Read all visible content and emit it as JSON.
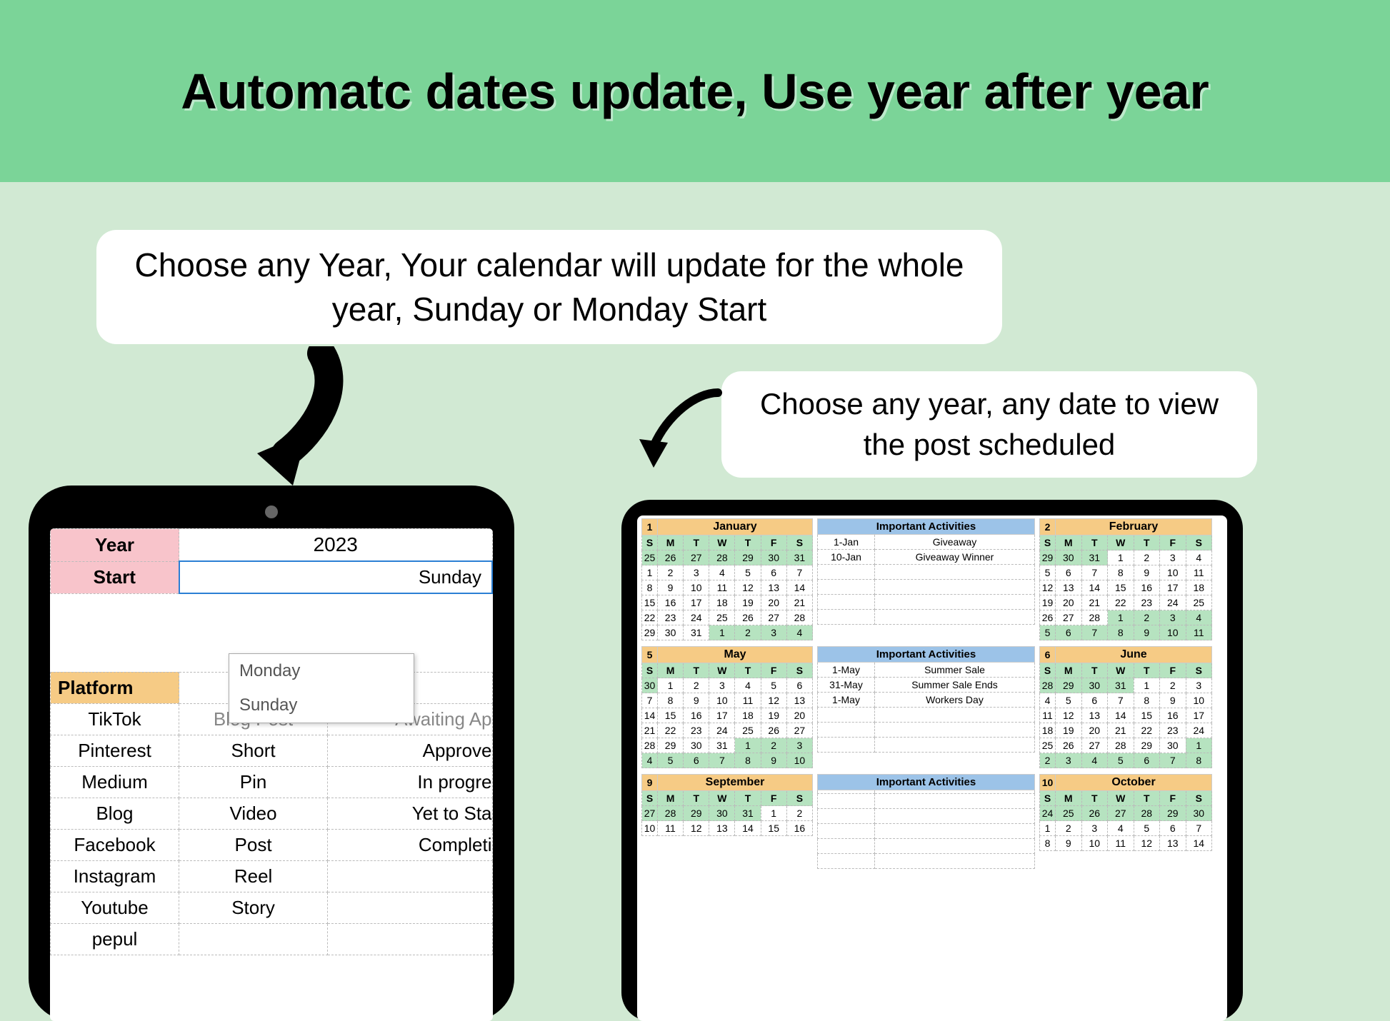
{
  "header": {
    "title": "Automatc dates update, Use year after year"
  },
  "caption1": "Choose any Year, Your calendar will update for the whole year, Sunday or Monday Start",
  "caption2": "Choose any year, any date to view the post scheduled",
  "sheet1": {
    "year_label": "Year",
    "year_value": "2023",
    "start_label": "Start",
    "start_value": "Sunday",
    "dropdown": [
      "Monday",
      "Sunday"
    ],
    "platform_header": "Platform",
    "rows": [
      {
        "platform": "TikTok",
        "type": "Blog Post",
        "status": "Awaiting Ap"
      },
      {
        "platform": "Pinterest",
        "type": "Short",
        "status": "Approve"
      },
      {
        "platform": "Medium",
        "type": "Pin",
        "status": "In progre"
      },
      {
        "platform": "Blog",
        "type": "Video",
        "status": "Yet to Sta"
      },
      {
        "platform": "Facebook",
        "type": "Post",
        "status": "Completi"
      },
      {
        "platform": "Instagram",
        "type": "Reel",
        "status": ""
      },
      {
        "platform": "Youtube",
        "type": "Story",
        "status": ""
      },
      {
        "platform": "pepul",
        "type": "",
        "status": ""
      }
    ]
  },
  "calendar": {
    "dow": [
      "S",
      "M",
      "T",
      "W",
      "T",
      "F",
      "S"
    ],
    "months": [
      {
        "num": "1",
        "name": "January",
        "activities_header": "Important Activities",
        "activities": [
          {
            "date": "1-Jan",
            "name": "Giveaway"
          },
          {
            "date": "10-Jan",
            "name": "Giveaway Winner"
          }
        ],
        "grid": [
          [
            "25p",
            "26p",
            "27p",
            "28p",
            "29p",
            "30p",
            "31p"
          ],
          [
            "1",
            "2",
            "3",
            "4",
            "5",
            "6",
            "7"
          ],
          [
            "8",
            "9",
            "10",
            "11",
            "12",
            "13",
            "14"
          ],
          [
            "15",
            "16",
            "17",
            "18",
            "19",
            "20",
            "21"
          ],
          [
            "22",
            "23",
            "24",
            "25",
            "26",
            "27",
            "28"
          ],
          [
            "29",
            "30",
            "31",
            "1n",
            "2n",
            "3n",
            "4n"
          ]
        ],
        "right_num": "2",
        "right_name": "February",
        "right_grid": [
          [
            "29p",
            "30p",
            "31p",
            "1",
            "2",
            "3",
            "4"
          ],
          [
            "5",
            "6",
            "7",
            "8",
            "9",
            "10",
            "11"
          ],
          [
            "12",
            "13",
            "14",
            "15",
            "16",
            "17",
            "18"
          ],
          [
            "19",
            "20",
            "21",
            "22",
            "23",
            "24",
            "25"
          ],
          [
            "26",
            "27",
            "28",
            "1n",
            "2n",
            "3n",
            "4n"
          ],
          [
            "5n",
            "6n",
            "7n",
            "8n",
            "9n",
            "10n",
            "11n"
          ]
        ]
      },
      {
        "num": "5",
        "name": "May",
        "activities_header": "Important Activities",
        "activities": [
          {
            "date": "1-May",
            "name": "Summer Sale"
          },
          {
            "date": "31-May",
            "name": "Summer Sale Ends"
          },
          {
            "date": "1-May",
            "name": "Workers Day"
          }
        ],
        "grid": [
          [
            "30p",
            "1",
            "2",
            "3",
            "4",
            "5",
            "6"
          ],
          [
            "7",
            "8",
            "9",
            "10",
            "11",
            "12",
            "13"
          ],
          [
            "14",
            "15",
            "16",
            "17",
            "18",
            "19",
            "20"
          ],
          [
            "21",
            "22",
            "23",
            "24",
            "25",
            "26",
            "27"
          ],
          [
            "28",
            "29",
            "30",
            "31",
            "1n",
            "2n",
            "3n"
          ],
          [
            "4n",
            "5n",
            "6n",
            "7n",
            "8n",
            "9n",
            "10n"
          ]
        ],
        "right_num": "6",
        "right_name": "June",
        "right_grid": [
          [
            "28p",
            "29p",
            "30p",
            "31p",
            "1",
            "2",
            "3"
          ],
          [
            "4",
            "5",
            "6",
            "7",
            "8",
            "9",
            "10"
          ],
          [
            "11",
            "12",
            "13",
            "14",
            "15",
            "16",
            "17"
          ],
          [
            "18",
            "19",
            "20",
            "21",
            "22",
            "23",
            "24"
          ],
          [
            "25",
            "26",
            "27",
            "28",
            "29",
            "30",
            "1n"
          ],
          [
            "2n",
            "3n",
            "4n",
            "5n",
            "6n",
            "7n",
            "8n"
          ]
        ]
      },
      {
        "num": "9",
        "name": "September",
        "activities_header": "Important Activities",
        "activities": [],
        "grid": [
          [
            "27p",
            "28p",
            "29p",
            "30p",
            "31p",
            "1",
            "2"
          ],
          [
            "10",
            "11",
            "12",
            "13",
            "14",
            "15",
            "16"
          ]
        ],
        "right_num": "10",
        "right_name": "October",
        "right_grid": [
          [
            "24p",
            "25p",
            "26p",
            "27p",
            "28p",
            "29p",
            "30p"
          ],
          [
            "1",
            "2",
            "3",
            "4",
            "5",
            "6",
            "7"
          ],
          [
            "8",
            "9",
            "10",
            "11",
            "12",
            "13",
            "14"
          ]
        ]
      }
    ]
  }
}
